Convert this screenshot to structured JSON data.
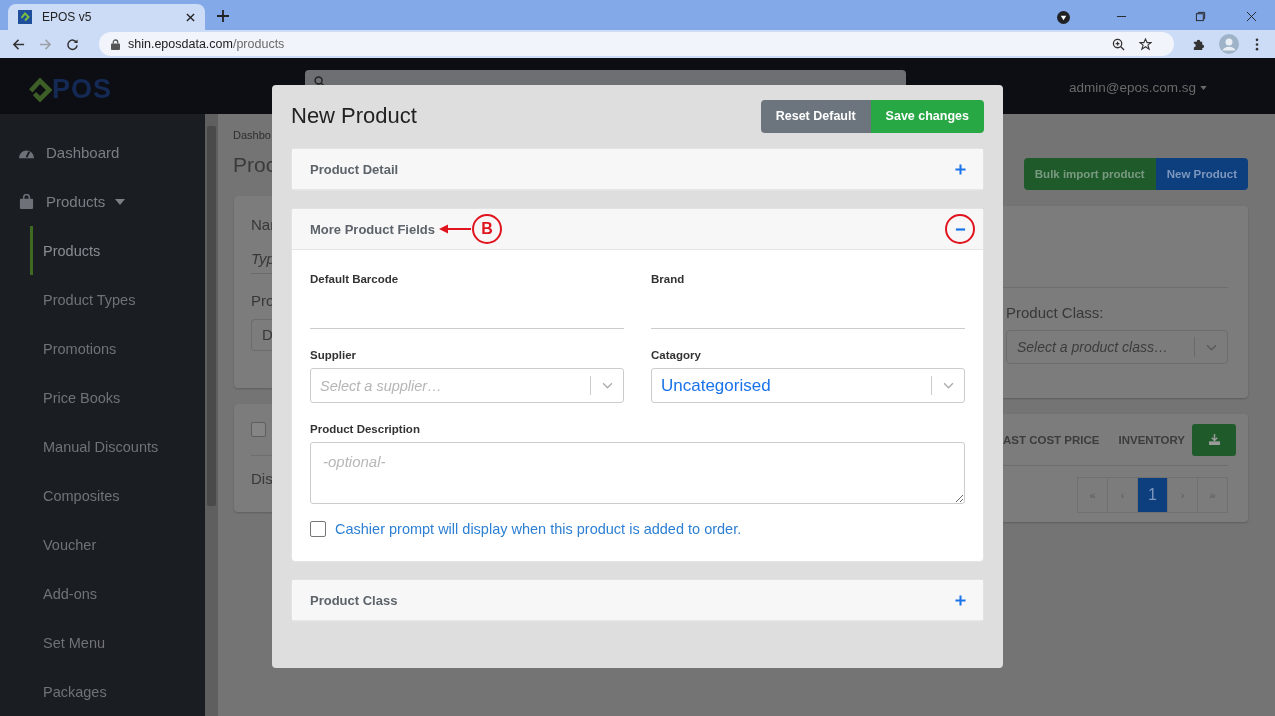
{
  "browser": {
    "tab": {
      "title": "EPOS v5"
    },
    "url": {
      "domain": "shin.eposdata.com",
      "path": "/products"
    }
  },
  "header": {
    "logo": "POS",
    "user": "admin@epos.com.sg"
  },
  "sidebar": {
    "items": [
      {
        "label": "Dashboard"
      },
      {
        "label": "Products",
        "expanded": true,
        "children": [
          {
            "label": "Products",
            "selected": true
          },
          {
            "label": "Product Types",
            "selected": false
          },
          {
            "label": "Promotions",
            "selected": false
          },
          {
            "label": "Price Books",
            "selected": false
          },
          {
            "label": "Manual Discounts",
            "selected": false
          },
          {
            "label": "Composites",
            "selected": false
          },
          {
            "label": "Voucher",
            "selected": false
          },
          {
            "label": "Add-ons",
            "selected": false
          },
          {
            "label": "Set Menu",
            "selected": false
          },
          {
            "label": "Packages",
            "selected": false
          }
        ]
      }
    ]
  },
  "page": {
    "breadcrumb": "Dashbo",
    "heading": "Proc",
    "buttons": [
      {
        "label": "Bulk import product",
        "kind": "success"
      },
      {
        "label": "New Product",
        "kind": "primary"
      }
    ],
    "filters": {
      "name_label": "Nar",
      "name_placeholder": "Typ",
      "type_label": "Pro",
      "type_value": "D",
      "class_label": "Product Class:",
      "class_placeholder": "Select a product class…"
    },
    "table": {
      "header_checked": false,
      "columns": [
        "AST COST PRICE",
        "INVENTORY"
      ],
      "footer_text": "Dis"
    },
    "pagination": [
      {
        "label": "«",
        "selected": false
      },
      {
        "label": "‹",
        "selected": false
      },
      {
        "label": "1",
        "selected": true
      },
      {
        "label": "›",
        "selected": false
      },
      {
        "label": "»",
        "selected": false
      }
    ]
  },
  "modal": {
    "title": "New Product",
    "buttons": [
      {
        "label": "Reset Default",
        "kind": "secondary"
      },
      {
        "label": "Save changes",
        "kind": "success"
      }
    ],
    "sections": [
      {
        "title": "Product Detail",
        "expanded": false,
        "highlighted": false
      },
      {
        "title": "More Product Fields",
        "expanded": true,
        "highlighted": true,
        "annotation": "B"
      },
      {
        "title": "Product Class",
        "expanded": false,
        "highlighted": false
      }
    ],
    "fields": [
      {
        "kind": "text",
        "label": "Default Barcode"
      },
      {
        "kind": "text",
        "label": "Brand"
      },
      {
        "kind": "select",
        "label": "Supplier",
        "placeholder": "Select a supplier…"
      },
      {
        "kind": "select",
        "label": "Catagory",
        "value": "Uncategorised"
      },
      {
        "kind": "textarea",
        "label": "Product Description",
        "placeholder": "-optional-"
      }
    ],
    "cashier_prompt": {
      "checked": false,
      "label": "Cashier prompt will display when this product is added to order."
    }
  }
}
